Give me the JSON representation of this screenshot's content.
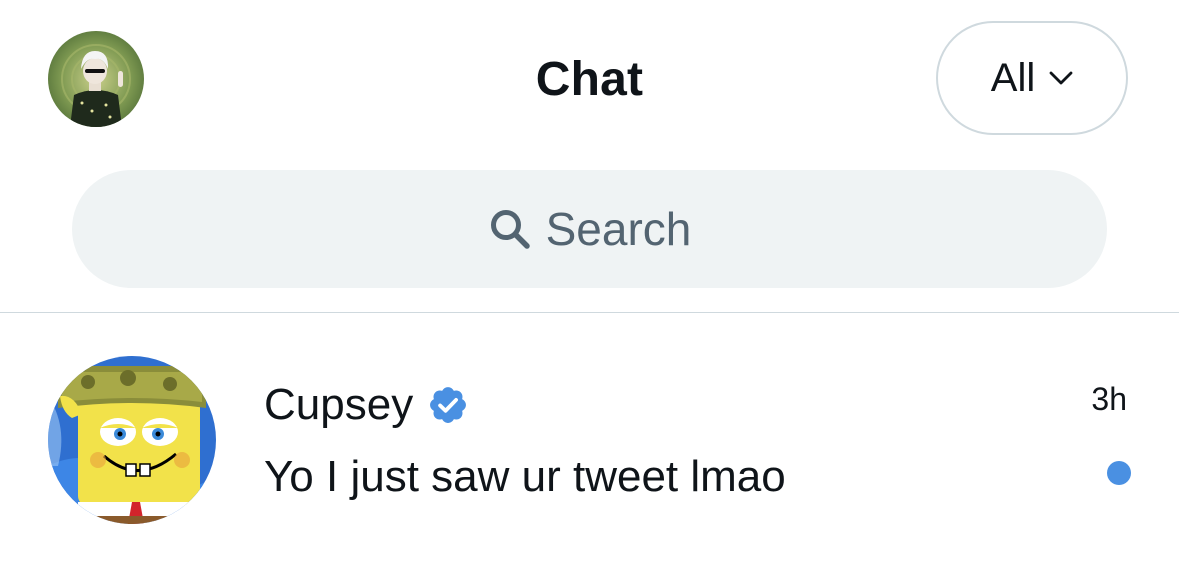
{
  "header": {
    "title": "Chat",
    "profile_avatar": "profile-avatar-image",
    "filter": {
      "label": "All",
      "icon": "chevron-down-icon"
    }
  },
  "search": {
    "placeholder": "Search",
    "icon": "search-icon"
  },
  "conversations": [
    {
      "name": "Cupsey",
      "verified": true,
      "time": "3h",
      "preview": "Yo I just saw ur tweet lmao",
      "unread": true,
      "avatar": "spongebob-avatar-image"
    }
  ],
  "colors": {
    "text": "#0f1419",
    "secondary_text": "#536471",
    "search_bg": "#eff3f4",
    "border": "#cfd9de",
    "accent": "#1d9bf0",
    "unread_dot": "#4a90e2"
  }
}
